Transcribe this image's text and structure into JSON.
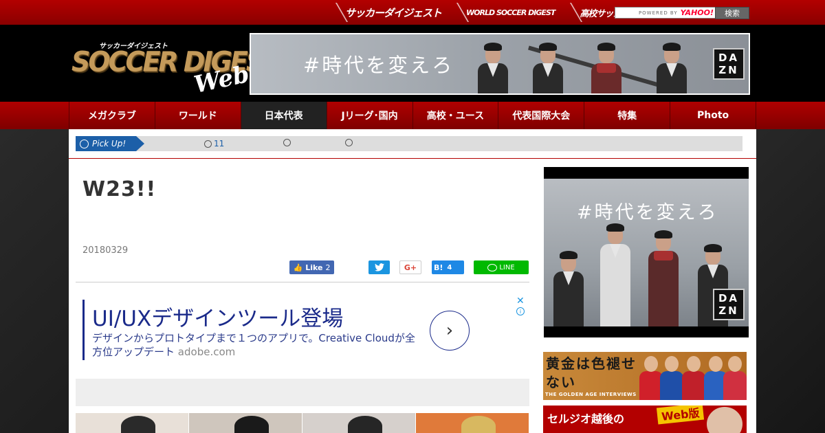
{
  "topbar": {
    "sitelinks": [
      "サッカーダイジェスト",
      "WORLD SOCCER DIGEST",
      "高校サッカーダイジェスト"
    ],
    "search": {
      "powered": "POWERED BY",
      "engine": "YAHOO!",
      "button": "検索"
    }
  },
  "header": {
    "logo_sub": "サッカーダイジェスト",
    "logo_main": "SOCCER DIGEST",
    "logo_web": "Web",
    "banner": {
      "text": "#時代を変えろ",
      "brand": [
        "DA",
        "ZN"
      ]
    }
  },
  "nav": {
    "items": [
      {
        "label": "メガクラブ",
        "active": false
      },
      {
        "label": "ワールド",
        "active": false
      },
      {
        "label": "日本代表",
        "active": true
      },
      {
        "label": "Jリーグ･国内",
        "active": false
      },
      {
        "label": "高校・ユース",
        "active": false
      },
      {
        "label": "代表国際大会",
        "active": false
      },
      {
        "label": "特集",
        "active": false
      },
      {
        "label": "Photo",
        "active": false
      }
    ]
  },
  "pickup": {
    "label": "Pick Up!",
    "items": [
      "11",
      "",
      ""
    ]
  },
  "article": {
    "title": "W23!!",
    "date": "20180329",
    "share": {
      "fb_label": "Like",
      "fb_count": "2",
      "gplus": "G+",
      "hatena": "B!",
      "hatena_count": "4",
      "line": "LINE"
    }
  },
  "ad": {
    "title": "UI/UXデザインツール登場",
    "desc": "デザインからプロトタイプまで１つのアプリで。Creative Cloudが全方位アップデート",
    "domain": "adobe.com",
    "close": "✕",
    "info": "i",
    "arrow": "›"
  },
  "sidebar": {
    "ad_text": "#時代を変えろ",
    "ad_brand": [
      "DA",
      "ZN"
    ],
    "banner1": {
      "title": "黄金は色褪せない",
      "sub": "THE GOLDEN AGE INTERVIEWS"
    },
    "banner2": {
      "title": "セルジオ越後の",
      "tag": "Web版"
    }
  }
}
